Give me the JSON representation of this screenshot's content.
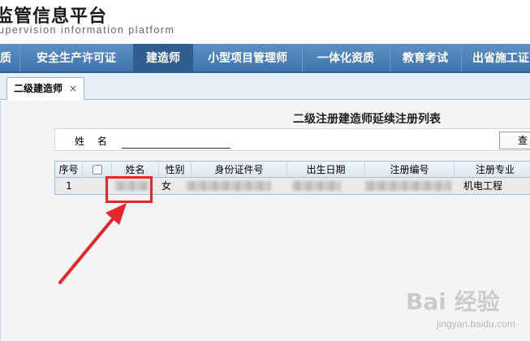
{
  "header": {
    "title": "监管信息平台",
    "subtitle": "upervision information platform"
  },
  "nav": {
    "items": [
      {
        "label": "质"
      },
      {
        "label": "安全生产许可证"
      },
      {
        "label": "建造师",
        "active": true
      },
      {
        "label": "小型项目管理师"
      },
      {
        "label": "一体化资质"
      },
      {
        "label": "教育考试"
      },
      {
        "label": "出省施工证"
      }
    ]
  },
  "tabs": [
    {
      "label": "二级建造师",
      "close": "×"
    }
  ],
  "page": {
    "heading": "二级注册建造师延续注册列表",
    "search": {
      "label": "姓 名",
      "value": "",
      "button_label": "查"
    }
  },
  "table": {
    "columns": [
      "序号",
      "",
      "姓名",
      "性别",
      "身份证件号",
      "出生日期",
      "注册编号",
      "注册专业"
    ],
    "rows": [
      {
        "index": "1",
        "name": "",
        "gender": "女",
        "id_number": "",
        "birth_date": "",
        "reg_number": "",
        "specialty": "机电工程"
      }
    ]
  },
  "watermark": {
    "logo": "Bai 经验",
    "url": "jingyan.baidu.com"
  },
  "colors": {
    "nav_bg": "#4a80b8",
    "nav_active": "#2f5f90",
    "annotation_red": "#e3272a"
  }
}
